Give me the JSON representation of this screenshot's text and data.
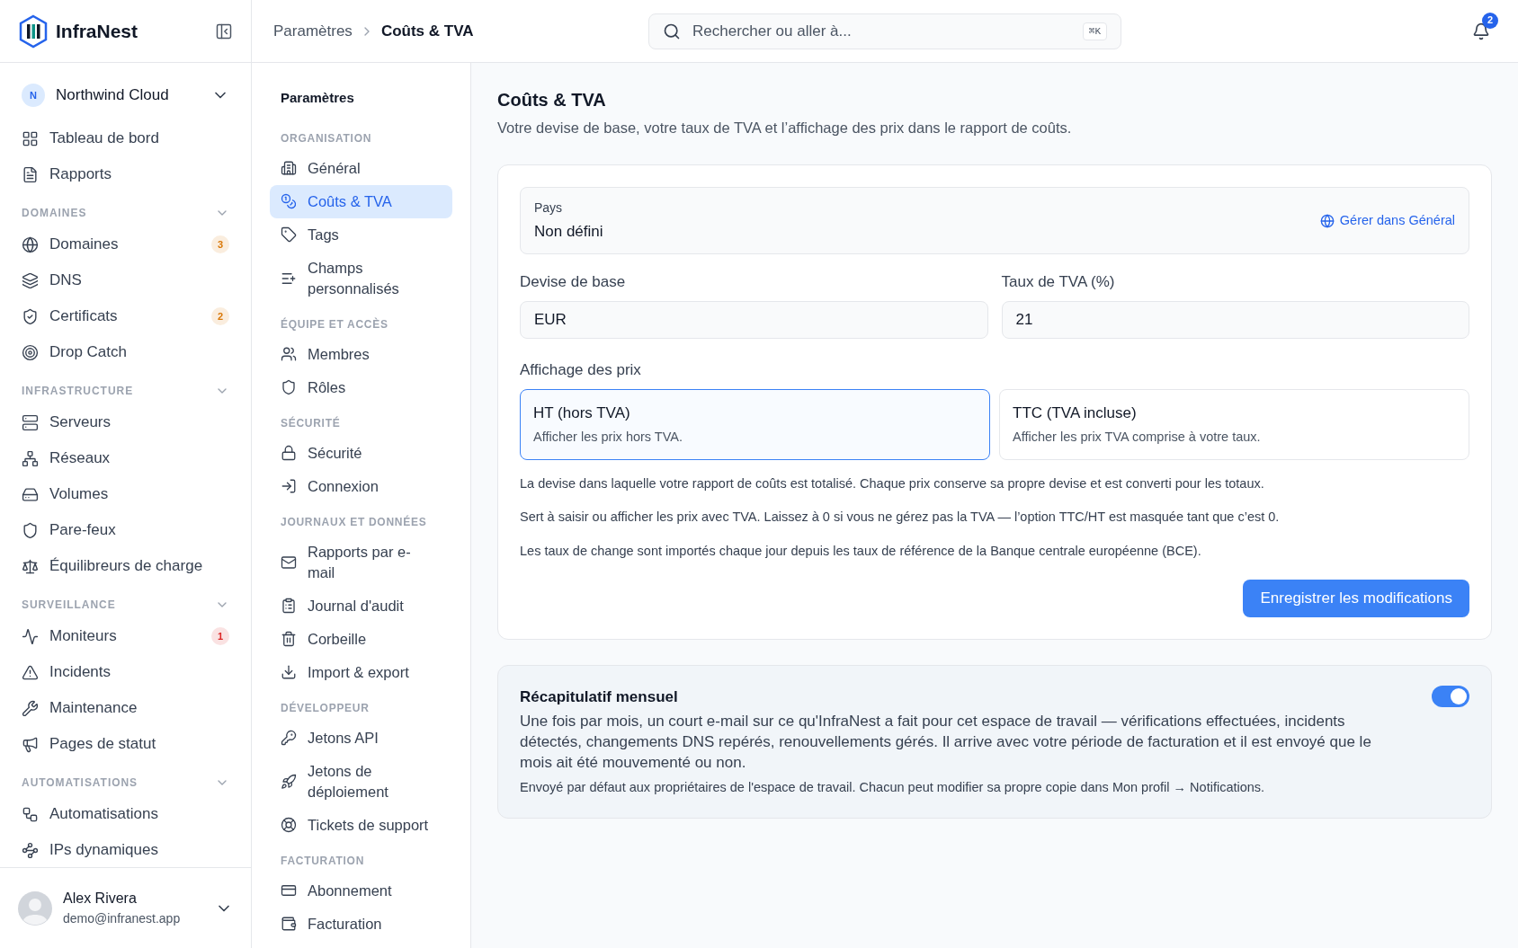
{
  "brand": {
    "name": "InfraNest"
  },
  "workspace": {
    "initial": "N",
    "name": "Northwind Cloud"
  },
  "sidebar": {
    "groups": [
      {
        "items": [
          {
            "label": "Tableau de bord"
          },
          {
            "label": "Rapports"
          }
        ]
      },
      {
        "title": "DOMAINES",
        "items": [
          {
            "label": "Domaines",
            "badge": "3",
            "color": "#d97706"
          },
          {
            "label": "DNS"
          },
          {
            "label": "Certificats",
            "badge": "2",
            "color": "#d97706"
          },
          {
            "label": "Drop Catch"
          }
        ]
      },
      {
        "title": "INFRASTRUCTURE",
        "items": [
          {
            "label": "Serveurs"
          },
          {
            "label": "Réseaux"
          },
          {
            "label": "Volumes"
          },
          {
            "label": "Pare-feux"
          },
          {
            "label": "Équilibreurs de charge"
          }
        ]
      },
      {
        "title": "SURVEILLANCE",
        "items": [
          {
            "label": "Moniteurs",
            "badge": "1",
            "color": "#dc2626"
          },
          {
            "label": "Incidents"
          },
          {
            "label": "Maintenance"
          },
          {
            "label": "Pages de statut"
          }
        ]
      },
      {
        "title": "AUTOMATISATIONS",
        "items": [
          {
            "label": "Automatisations"
          },
          {
            "label": "IPs dynamiques"
          }
        ]
      }
    ]
  },
  "user": {
    "name": "Alex Rivera",
    "email": "demo@infranest.app"
  },
  "breadcrumb": [
    "Paramètres",
    "Coûts & TVA"
  ],
  "search": {
    "placeholder": "Rechercher ou aller à...",
    "shortcut": "⌘K"
  },
  "notifications": {
    "count": "2"
  },
  "settings_nav": {
    "title": "Paramètres",
    "sections": [
      {
        "title": "ORGANISATION",
        "items": [
          {
            "label": "Général",
            "selected": false
          },
          {
            "label": "Coûts & TVA",
            "selected": true
          },
          {
            "label": "Tags",
            "selected": false
          },
          {
            "label": "Champs personnalisés",
            "selected": false
          }
        ]
      },
      {
        "title": "ÉQUIPE ET ACCÈS",
        "items": [
          {
            "label": "Membres",
            "selected": false
          },
          {
            "label": "Rôles",
            "selected": false
          }
        ]
      },
      {
        "title": "SÉCURITÉ",
        "items": [
          {
            "label": "Sécurité",
            "selected": false
          },
          {
            "label": "Connexion",
            "selected": false
          }
        ]
      },
      {
        "title": "JOURNAUX ET DONNÉES",
        "items": [
          {
            "label": "Rapports par e-mail",
            "selected": false
          },
          {
            "label": "Journal d'audit",
            "selected": false
          },
          {
            "label": "Corbeille",
            "selected": false
          },
          {
            "label": "Import & export",
            "selected": false
          }
        ]
      },
      {
        "title": "DÉVELOPPEUR",
        "items": [
          {
            "label": "Jetons API",
            "selected": false
          },
          {
            "label": "Jetons de déploiement",
            "selected": false
          },
          {
            "label": "Tickets de support",
            "selected": false
          }
        ]
      },
      {
        "title": "FACTURATION",
        "items": [
          {
            "label": "Abonnement",
            "selected": false
          },
          {
            "label": "Facturation",
            "selected": false
          }
        ]
      }
    ]
  },
  "page": {
    "title": "Coûts & TVA",
    "subtitle": "Votre devise de base, votre taux de TVA et l’affichage des prix dans le rapport de coûts."
  },
  "country": {
    "label": "Pays",
    "value": "Non défini",
    "link": "Gérer dans Général"
  },
  "fields": [
    {
      "label": "Devise de base",
      "value": "EUR"
    },
    {
      "label": "Taux de TVA (%)",
      "value": "21"
    }
  ],
  "price_display": {
    "label": "Affichage des prix",
    "options": [
      {
        "title": "HT (hors TVA)",
        "description": "Afficher les prix hors TVA.",
        "selected": true
      },
      {
        "title": "TTC (TVA incluse)",
        "description": "Afficher les prix TVA comprise à votre taux.",
        "selected": false
      }
    ]
  },
  "notes": [
    "La devise dans laquelle votre rapport de coûts est totalisé. Chaque prix conserve sa propre devise et est converti pour les totaux.",
    "Sert à saisir ou afficher les prix avec TVA. Laissez à 0 si vous ne gérez pas la TVA — l’option TTC/HT est masquée tant que c’est 0.",
    "Les taux de change sont importés chaque jour depuis les taux de référence de la Banque centrale européenne (BCE)."
  ],
  "save_button": "Enregistrer les modifications",
  "monthly_summary": {
    "title": "Récapitulatif mensuel",
    "description": "Une fois par mois, un court e-mail sur ce qu'InfraNest a fait pour cet espace de travail — vérifications effectuées, incidents détectés, changements DNS repérés, renouvellements gérés. Il arrive avec votre période de facturation et il est envoyé que le mois ait été mouvementé ou non.",
    "note": "Envoyé par défaut aux propriétaires de l'espace de travail. Chacun peut modifier sa propre copie dans Mon profil → Notifications.",
    "on": true
  }
}
